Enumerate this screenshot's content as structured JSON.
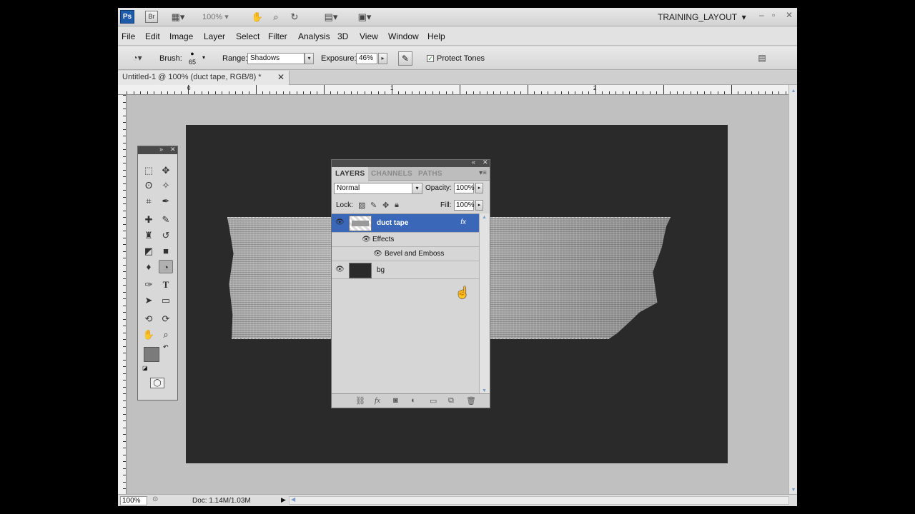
{
  "appbar": {
    "ps_logo": "Ps",
    "br_logo": "Br",
    "zoom_level": "100%",
    "workspace": "TRAINING_LAYOUT",
    "icons": [
      "view-extras-icon",
      "hand-tool-icon",
      "zoom-tool-icon",
      "rotate-view-icon",
      "arrange-documents-icon",
      "screen-mode-icon"
    ]
  },
  "menu": {
    "items": [
      "File",
      "Edit",
      "Image",
      "Layer",
      "Select",
      "Filter",
      "Analysis",
      "3D",
      "View",
      "Window",
      "Help"
    ]
  },
  "options": {
    "brush_label": "Brush:",
    "brush_size": "65",
    "range_label": "Range:",
    "range_value": "Shadows",
    "exposure_label": "Exposure:",
    "exposure_value": "46%",
    "protect_tones_label": "Protect Tones",
    "protect_tones_checked": true
  },
  "document": {
    "tab_title": "Untitled-1 @ 100% (duct tape, RGB/8) *",
    "ruler_h_numbers": [
      "0",
      "1",
      "2"
    ],
    "canvas_color": "#2a2a2a"
  },
  "status": {
    "zoom": "100%",
    "doc_info": "Doc: 1.14M/1.03M"
  },
  "tools": {
    "icons": [
      "marquee-icon",
      "move-icon",
      "lasso-icon",
      "magic-wand-icon",
      "crop-icon",
      "eyedropper-icon",
      "healing-brush-icon",
      "brush-icon",
      "clone-stamp-icon",
      "history-brush-icon",
      "eraser-icon",
      "gradient-icon",
      "blur-icon",
      "burn-icon",
      "pen-icon",
      "type-icon",
      "path-selection-icon",
      "shape-icon",
      "3d-rotate-icon",
      "3d-orbit-icon",
      "hand-icon",
      "zoom-icon"
    ],
    "foreground_color": "#7b7b7b",
    "background_color": "#ffffff"
  },
  "layers_panel": {
    "tabs": [
      "LAYERS",
      "CHANNELS",
      "PATHS"
    ],
    "active_tab": "LAYERS",
    "blend_mode": "Normal",
    "opacity_label": "Opacity:",
    "opacity_value": "100%",
    "lock_label": "Lock:",
    "fill_label": "Fill:",
    "fill_value": "100%",
    "layers": [
      {
        "name": "duct tape",
        "selected": true,
        "has_fx": true
      },
      {
        "name": "bg",
        "selected": false,
        "has_fx": false
      }
    ],
    "effects_label": "Effects",
    "effect_name": "Bevel and Emboss",
    "selection_color": "#3a67b8"
  }
}
